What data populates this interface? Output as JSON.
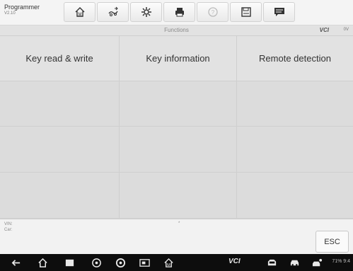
{
  "app": {
    "name": "Programmer",
    "version": "V2.10"
  },
  "toolbar": {
    "buttons": [
      {
        "icon": "home-icon"
      },
      {
        "icon": "vehicle-swap-icon"
      },
      {
        "icon": "settings-icon"
      },
      {
        "icon": "print-icon"
      },
      {
        "icon": "help-icon"
      },
      {
        "icon": "save-icon"
      },
      {
        "icon": "data-log-icon"
      }
    ]
  },
  "subheader": {
    "title": "Functions",
    "vci": "VCI",
    "battery": "0V"
  },
  "functions": {
    "items": [
      "Key read & write",
      "Key information",
      "Remote detection"
    ]
  },
  "info": {
    "vin_label": "VIN:",
    "car_label": "Car:",
    "marker": "*"
  },
  "esc_label": "ESC",
  "navbar": {
    "vci_label": "VCI",
    "status": "71% 9:4"
  },
  "colors": {
    "toolbar": "#f4f4f4",
    "grid": "#dcdcdc",
    "navbar": "#0d0d0d"
  }
}
